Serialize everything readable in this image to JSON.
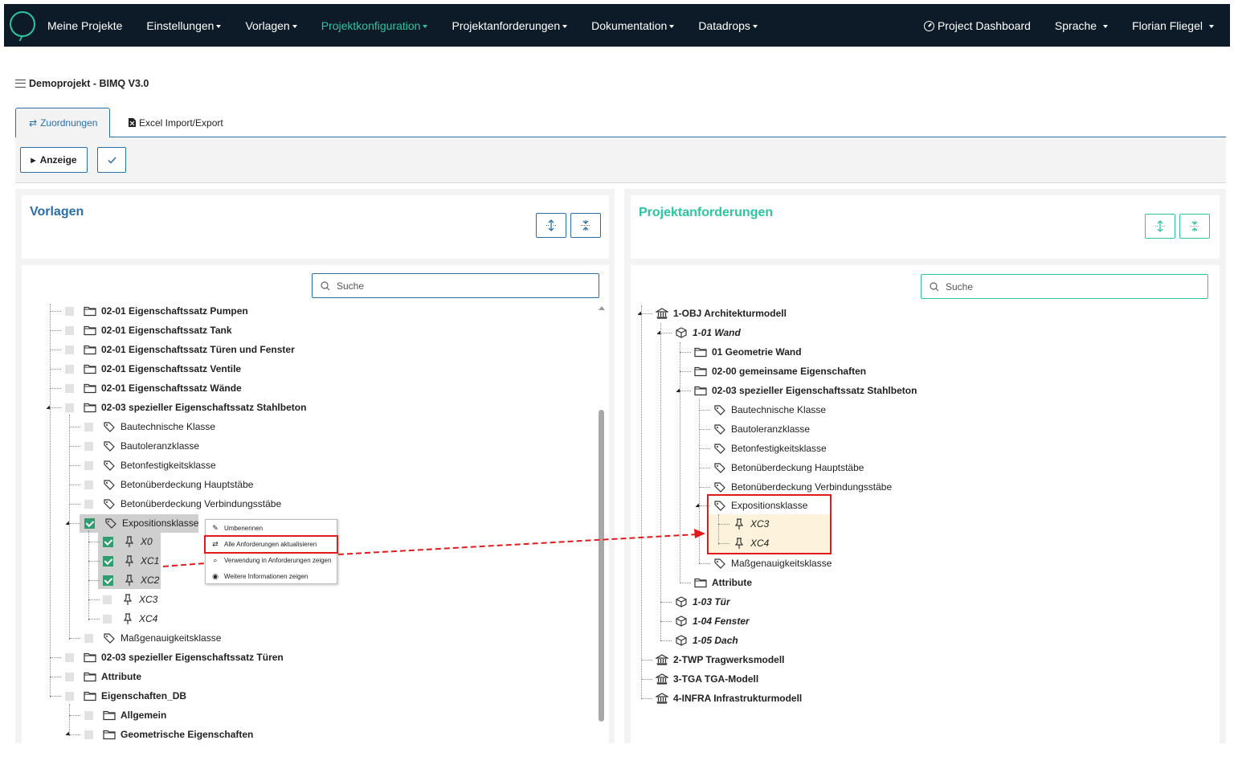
{
  "nav": {
    "items": [
      {
        "label": "Meine Projekte",
        "caret": false,
        "active": false
      },
      {
        "label": "Einstellungen",
        "caret": true,
        "active": false
      },
      {
        "label": "Vorlagen",
        "caret": true,
        "active": false
      },
      {
        "label": "Projektkonfiguration",
        "caret": true,
        "active": true
      },
      {
        "label": "Projektanforderungen",
        "caret": true,
        "active": false
      },
      {
        "label": "Dokumentation",
        "caret": true,
        "active": false
      },
      {
        "label": "Datadrops",
        "caret": true,
        "active": false
      }
    ],
    "dashboard": "Project Dashboard",
    "language": "Sprache",
    "user": "Florian Fliegel",
    "accent_color": "#2ec4a0",
    "bg_color": "#0c1b27"
  },
  "project": {
    "title": "Demoprojekt - BIMQ V3.0"
  },
  "tabs": {
    "zuordnungen": "Zuordnungen",
    "excel": "Excel Import/Export"
  },
  "toolbar": {
    "anzeige": "Anzeige"
  },
  "left_panel": {
    "title": "Vorlagen",
    "search_placeholder": "Suche",
    "rows": [
      {
        "label": "02-01 Eigenschaftssatz Pumpen",
        "icon": "folder-icon",
        "bold": true
      },
      {
        "label": "02-01 Eigenschaftssatz Tank",
        "icon": "folder-icon",
        "bold": true
      },
      {
        "label": "02-01 Eigenschaftssatz Türen und Fenster",
        "icon": "folder-icon",
        "bold": true
      },
      {
        "label": "02-01 Eigenschaftssatz Ventile",
        "icon": "folder-icon",
        "bold": true
      },
      {
        "label": "02-01 Eigenschaftssatz Wände",
        "icon": "folder-icon",
        "bold": true
      },
      {
        "label": "02-03 spezieller Eigenschaftssatz Stahlbeton",
        "icon": "folder-icon",
        "bold": true
      },
      {
        "label": "Bautechnische Klasse",
        "icon": "tag-icon"
      },
      {
        "label": "Bautoleranzklasse",
        "icon": "tag-icon"
      },
      {
        "label": "Betonfestigkeitsklasse",
        "icon": "tag-icon"
      },
      {
        "label": "Betonüberdeckung Hauptstäbe",
        "icon": "tag-icon"
      },
      {
        "label": "Betonüberdeckung Verbindungsstäbe",
        "icon": "tag-icon"
      },
      {
        "label": "Expositionsklasse",
        "icon": "tag-icon",
        "checked": true
      },
      {
        "label": "X0",
        "icon": "pin-icon",
        "italic": true,
        "checked": true
      },
      {
        "label": "XC1",
        "icon": "pin-icon",
        "italic": true,
        "checked": true
      },
      {
        "label": "XC2",
        "icon": "pin-icon",
        "italic": true,
        "checked": true
      },
      {
        "label": "XC3",
        "icon": "pin-icon",
        "italic": true
      },
      {
        "label": "XC4",
        "icon": "pin-icon",
        "italic": true
      },
      {
        "label": "Maßgenauigkeitsklasse",
        "icon": "tag-icon"
      },
      {
        "label": "02-03 spezieller Eigenschaftssatz Türen",
        "icon": "folder-icon",
        "bold": true
      },
      {
        "label": "Attribute",
        "icon": "folder-icon",
        "bold": true
      },
      {
        "label": "Eigenschaften_DB",
        "icon": "folder-icon",
        "bold": true
      },
      {
        "label": "Allgemein",
        "icon": "folder-icon",
        "bold": true
      },
      {
        "label": "Geometrische Eigenschaften",
        "icon": "folder-icon",
        "bold": true
      }
    ]
  },
  "context_menu": {
    "items": [
      {
        "label": "Umbenennen",
        "icon": "pencil-icon"
      },
      {
        "label": "Alle Anforderungen aktualisieren",
        "icon": "swap-icon"
      },
      {
        "label": "Verwendung in Anforderungen zeigen",
        "icon": "search-icon"
      },
      {
        "label": "Weitere Informationen zeigen",
        "icon": "eye-icon"
      }
    ]
  },
  "right_panel": {
    "title": "Projektanforderungen",
    "search_placeholder": "Suche",
    "rows": [
      {
        "label": "1-OBJ Architekturmodell",
        "icon": "building-icon",
        "bold": true
      },
      {
        "label": "1-01 Wand",
        "icon": "cube-icon",
        "bold": true,
        "italic": true
      },
      {
        "label": "01 Geometrie Wand",
        "icon": "folder-icon",
        "bold": true
      },
      {
        "label": "02-00 gemeinsame Eigenschaften",
        "icon": "folder-icon",
        "bold": true
      },
      {
        "label": "02-03 spezieller Eigenschaftssatz Stahlbeton",
        "icon": "folder-icon",
        "bold": true
      },
      {
        "label": "Bautechnische Klasse",
        "icon": "tag-icon"
      },
      {
        "label": "Bautoleranzklasse",
        "icon": "tag-icon"
      },
      {
        "label": "Betonfestigkeitsklasse",
        "icon": "tag-icon"
      },
      {
        "label": "Betonüberdeckung Hauptstäbe",
        "icon": "tag-icon"
      },
      {
        "label": "Betonüberdeckung Verbindungsstäbe",
        "icon": "tag-icon"
      },
      {
        "label": "Expositionsklasse",
        "icon": "tag-icon"
      },
      {
        "label": "XC3",
        "icon": "pin-icon",
        "italic": true
      },
      {
        "label": "XC4",
        "icon": "pin-icon",
        "italic": true
      },
      {
        "label": "Maßgenauigkeitsklasse",
        "icon": "tag-icon"
      },
      {
        "label": "Attribute",
        "icon": "folder-icon",
        "bold": true
      },
      {
        "label": "1-03 Tür",
        "icon": "cube-icon",
        "bold": true,
        "italic": true
      },
      {
        "label": "1-04 Fenster",
        "icon": "cube-icon",
        "bold": true,
        "italic": true
      },
      {
        "label": "1-05 Dach",
        "icon": "cube-icon",
        "bold": true,
        "italic": true
      },
      {
        "label": "2-TWP Tragwerksmodell",
        "icon": "building-icon",
        "bold": true
      },
      {
        "label": "3-TGA TGA-Modell",
        "icon": "building-icon",
        "bold": true
      },
      {
        "label": "4-INFRA Infrastrukturmodell",
        "icon": "building-icon",
        "bold": true
      }
    ]
  },
  "colors": {
    "blue": "#2a6fa8",
    "green": "#2ec4a0",
    "red": "#e01b1b",
    "highlight": "#fdf3dc"
  }
}
